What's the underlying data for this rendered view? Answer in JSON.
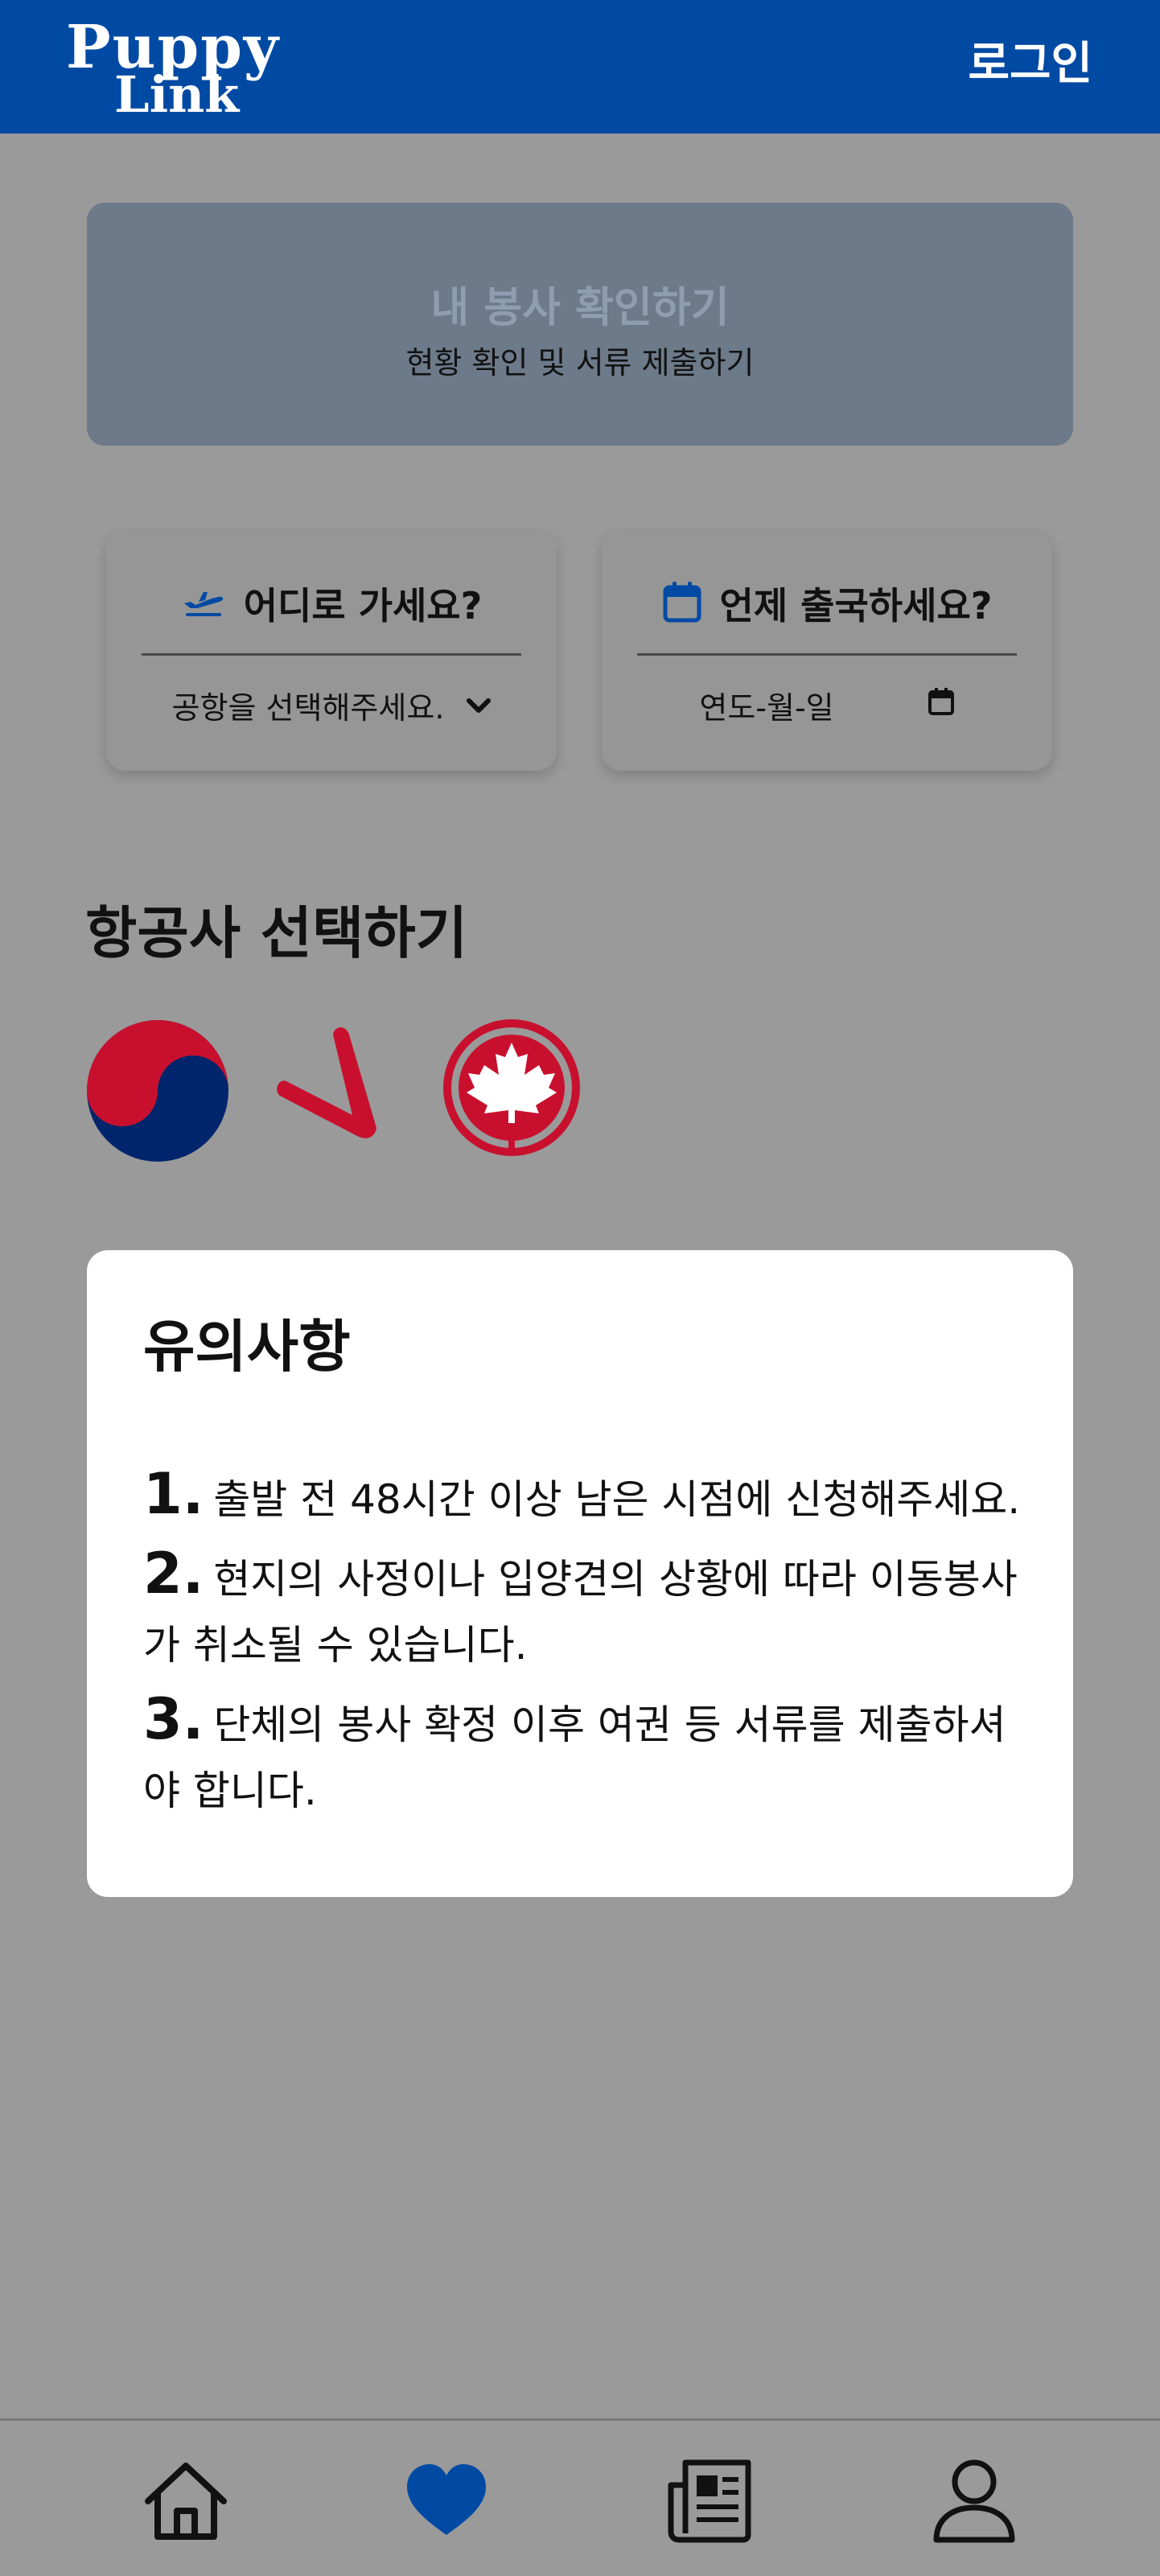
{
  "header": {
    "logo_line1": "Puppy",
    "logo_line2": "Link",
    "login_label": "로그인"
  },
  "banner": {
    "title": "내 봉사 확인하기",
    "subtitle": "현황 확인 및 서류 제출하기"
  },
  "destination": {
    "label": "어디로 가세요?",
    "icon": "airplane-icon",
    "value": "공항을 선택해주세요."
  },
  "departure_date": {
    "label": "언제 출국하세요?",
    "icon": "calendar-icon",
    "value": "연도-월-일"
  },
  "airlines_section": {
    "title": "항공사 선택하기",
    "airlines": [
      {
        "icon": "korean-air-logo"
      },
      {
        "icon": "jin-air-logo"
      },
      {
        "icon": "air-canada-logo"
      }
    ]
  },
  "notice": {
    "title": "유의사항",
    "items": [
      {
        "num": "1.",
        "text": "출발 전 48시간 이상 남은 시점에 신청해주세요."
      },
      {
        "num": "2.",
        "text": "현지의 사정이나 입양견의 상황에 따라 이동봉사가 취소될 수 있습니다."
      },
      {
        "num": "3.",
        "text": "단체의 봉사 확정 이후 여권 등 서류를 제출하셔야 합니다."
      }
    ]
  },
  "bottom_nav": [
    {
      "icon": "home-icon"
    },
    {
      "icon": "heart-icon",
      "active": true
    },
    {
      "icon": "newspaper-icon"
    },
    {
      "icon": "user-icon"
    }
  ],
  "colors": {
    "brand": "#004aa4",
    "overlay_background": "#9a9a9a",
    "airline_red": "#c8102e",
    "korean_air_blue": "#00256c"
  }
}
